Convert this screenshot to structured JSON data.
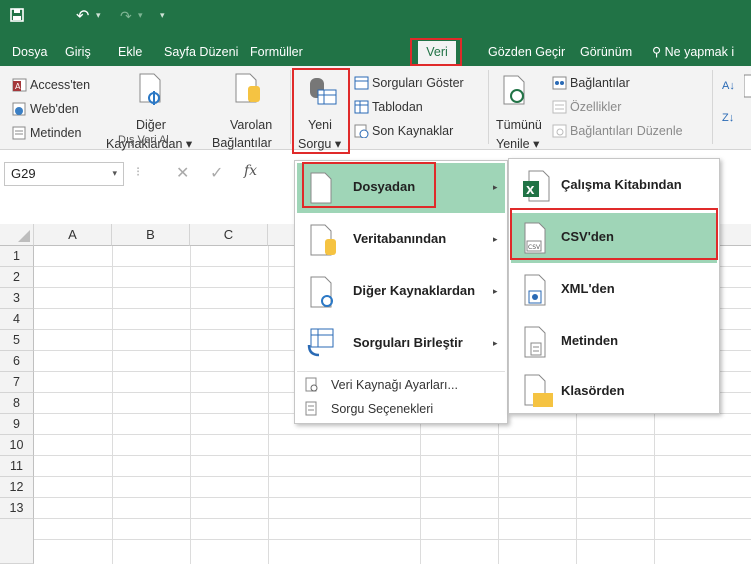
{
  "quick_access": {
    "save_icon": "save-icon",
    "undo_icon": "undo-icon",
    "redo_icon": "redo-icon"
  },
  "tabs": [
    "Dosya",
    "Giriş",
    "Ekle",
    "Sayfa Düzeni",
    "Formüller",
    "Veri",
    "Gözden Geçir",
    "Görünüm",
    "Ne yapmak i"
  ],
  "active_tab": "Veri",
  "ribbon": {
    "access": "Access'ten",
    "web": "Web'den",
    "text": "Metinden",
    "other_line1": "Diğer",
    "other_line2": "Kaynaklardan",
    "existing_line1": "Varolan",
    "existing_line2": "Bağlantılar",
    "group_external": "Dış Veri Al",
    "newquery_line1": "Yeni",
    "newquery_line2": "Sorgu",
    "show_queries": "Sorguları Göster",
    "from_table": "Tablodan",
    "recent_sources": "Son Kaynaklar",
    "refresh_line1": "Tümünü",
    "refresh_line2": "Yenile",
    "connections": "Bağlantılar",
    "properties": "Özellikler",
    "edit_links": "Bağlantıları Düzenle"
  },
  "formula_bar": {
    "name_box": "G29",
    "fx": "fx"
  },
  "columns": [
    "A",
    "B",
    "C"
  ],
  "rows": [
    "1",
    "2",
    "3",
    "4",
    "5",
    "6",
    "7",
    "8",
    "9",
    "10",
    "11",
    "12",
    "13"
  ],
  "menu1": {
    "items": [
      "Dosyadan",
      "Veritabanından",
      "Diğer Kaynaklardan",
      "Sorguları Birleştir"
    ],
    "small_items": [
      "Veri Kaynağı Ayarları...",
      "Sorgu Seçenekleri"
    ]
  },
  "menu2": {
    "items": [
      "Çalışma Kitabından",
      "CSV'den",
      "XML'den",
      "Metinden",
      "Klasörden"
    ]
  },
  "colors": {
    "brand": "#217346",
    "highlight": "#9fd5b7",
    "annotation": "#e02a2a"
  }
}
